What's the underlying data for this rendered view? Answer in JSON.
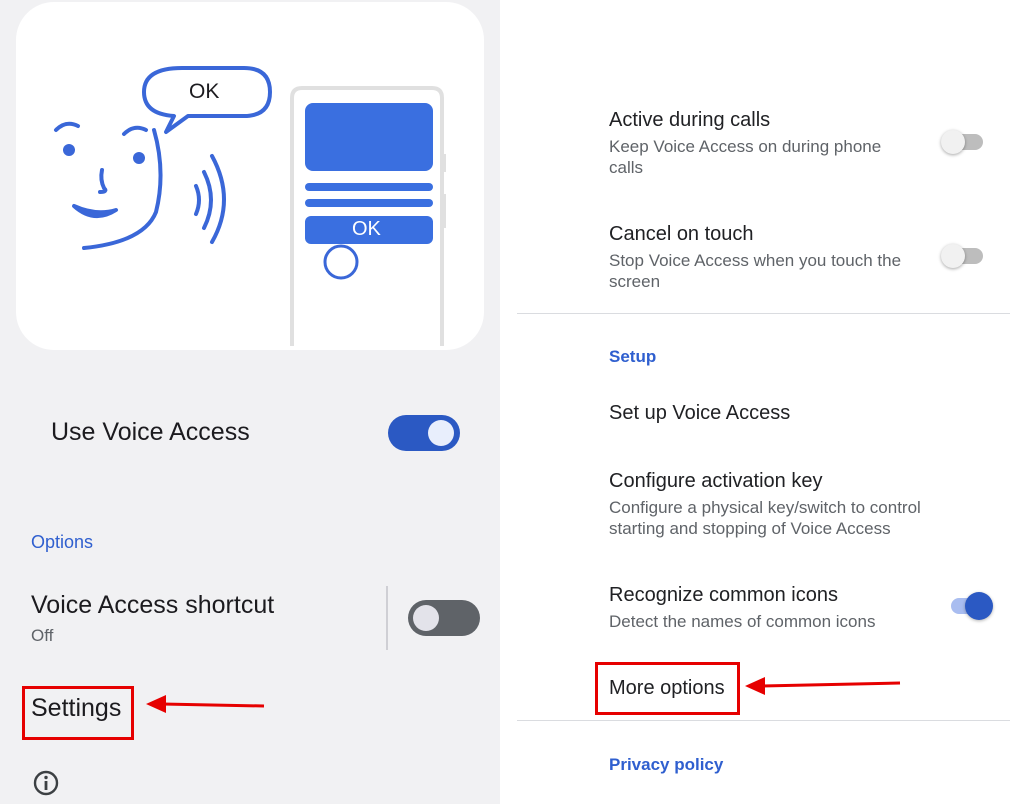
{
  "left": {
    "illustration": {
      "bubble_text": "OK",
      "phone_button_text": "OK"
    },
    "use_voice_access": {
      "label": "Use Voice Access",
      "enabled": true
    },
    "options_header": "Options",
    "shortcut": {
      "title": "Voice Access shortcut",
      "status": "Off",
      "enabled": false
    },
    "settings_label": "Settings",
    "info_icon": "info-icon"
  },
  "right": {
    "active_during_calls": {
      "title": "Active during calls",
      "subtitle": "Keep Voice Access on during phone calls",
      "enabled": false
    },
    "cancel_on_touch": {
      "title": "Cancel on touch",
      "subtitle": "Stop Voice Access when you touch the screen",
      "enabled": false
    },
    "setup_header": "Setup",
    "setup_voice_access": "Set up Voice Access",
    "configure_activation_key": {
      "title": "Configure activation key",
      "subtitle": "Configure a physical key/switch to control starting and stopping of Voice Access"
    },
    "recognize_icons": {
      "title": "Recognize common icons",
      "subtitle": "Detect the names of common icons",
      "enabled": true
    },
    "more_options": "More options",
    "privacy_policy": "Privacy policy"
  },
  "annotations": {
    "highlight_color": "#e60000"
  },
  "colors": {
    "accent": "#2f5fcf",
    "toggle_on": "#2b59c3",
    "toggle_off_track": "#5f6368"
  }
}
